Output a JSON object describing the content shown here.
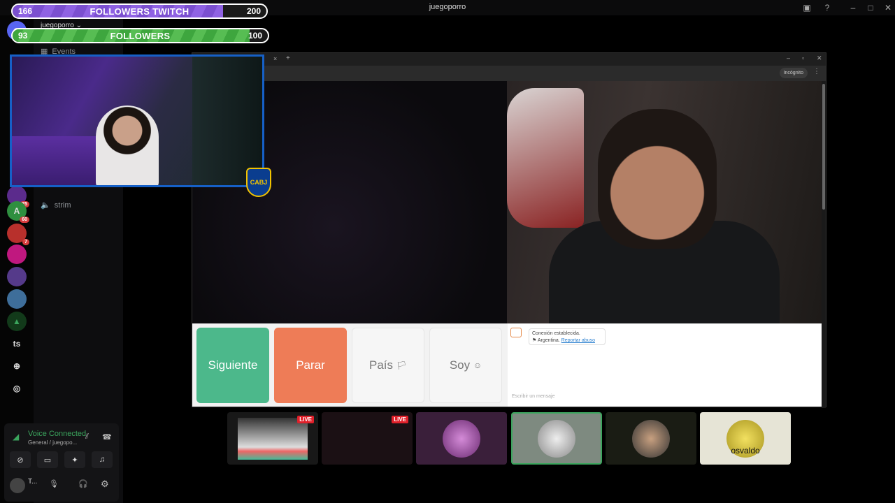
{
  "window": {
    "title": "juegoporro"
  },
  "overlays": {
    "twitch_followers": {
      "current": "166",
      "label": "FOLLOWERS TWITCH",
      "goal": "200",
      "progress": 0.83,
      "color": "#7b4fd0"
    },
    "followers": {
      "current": "93",
      "label": "FOLLOWERS",
      "goal": "100",
      "progress": 0.93,
      "color": "#3ea63e"
    },
    "crest_text": "CABJ"
  },
  "server": {
    "name": "juegoporro",
    "chevron": "⌄"
  },
  "channels": [
    {
      "icon": "calendar-icon",
      "label": "Events"
    },
    {
      "icon": "speaker-icon",
      "label": "strim"
    }
  ],
  "rail": {
    "badges": [
      "25",
      "60",
      "7"
    ],
    "ts_label": "ts"
  },
  "browser": {
    "incognito_label": "Incógnito",
    "buttons": {
      "next": "Siguiente",
      "stop": "Parar",
      "country": "País",
      "me": "Soy"
    },
    "chat": {
      "status": "Conexión establecida.",
      "country": "Argentina.",
      "report": "Reportar abuso",
      "placeholder": "Escribir un mensaje"
    },
    "colors": {
      "next": "#4cb88b",
      "stop": "#ee7c57"
    }
  },
  "voice": {
    "status": "Voice Connected",
    "channel": "General / juegopo..."
  },
  "user": {
    "name": "T..."
  },
  "tiles": [
    {
      "live": "LIVE"
    },
    {
      "live": "LIVE"
    },
    {
      "live": ""
    },
    {
      "live": ""
    },
    {
      "live": ""
    },
    {
      "caption": "osvaldo"
    }
  ]
}
